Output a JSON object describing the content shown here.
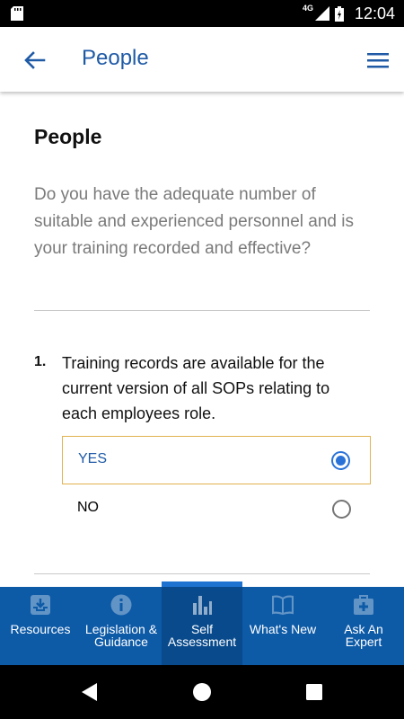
{
  "status_bar": {
    "network": "4G",
    "time": "12:04"
  },
  "app_bar": {
    "title": "People",
    "back_icon": "arrow-left-icon",
    "menu_icon": "hamburger-menu-icon"
  },
  "section": {
    "title": "People",
    "description": "Do you have the adequate number of suitable and experienced personnel and is your training recorded and effective?"
  },
  "question": {
    "number": "1.",
    "text": "Training records are available for the current version of all SOPs relating to each employees role.",
    "options": [
      {
        "label": "YES",
        "selected": true
      },
      {
        "label": "NO",
        "selected": false
      }
    ]
  },
  "bottom_nav": {
    "items": [
      {
        "label": "Resources",
        "icon": "inbox-download-icon",
        "active": false
      },
      {
        "label": "Legislation & Guidance",
        "icon": "info-icon",
        "active": false
      },
      {
        "label": "Self Assessment",
        "icon": "bar-chart-icon",
        "active": true
      },
      {
        "label": "What's New",
        "icon": "open-book-icon",
        "active": false
      },
      {
        "label": "Ask An Expert",
        "icon": "first-aid-kit-icon",
        "active": false
      }
    ]
  },
  "colors": {
    "primary": "#0d5aa7",
    "title_blue": "#1f5aa6",
    "radio_blue": "#2a72d8",
    "selected_border": "#e2b350"
  }
}
